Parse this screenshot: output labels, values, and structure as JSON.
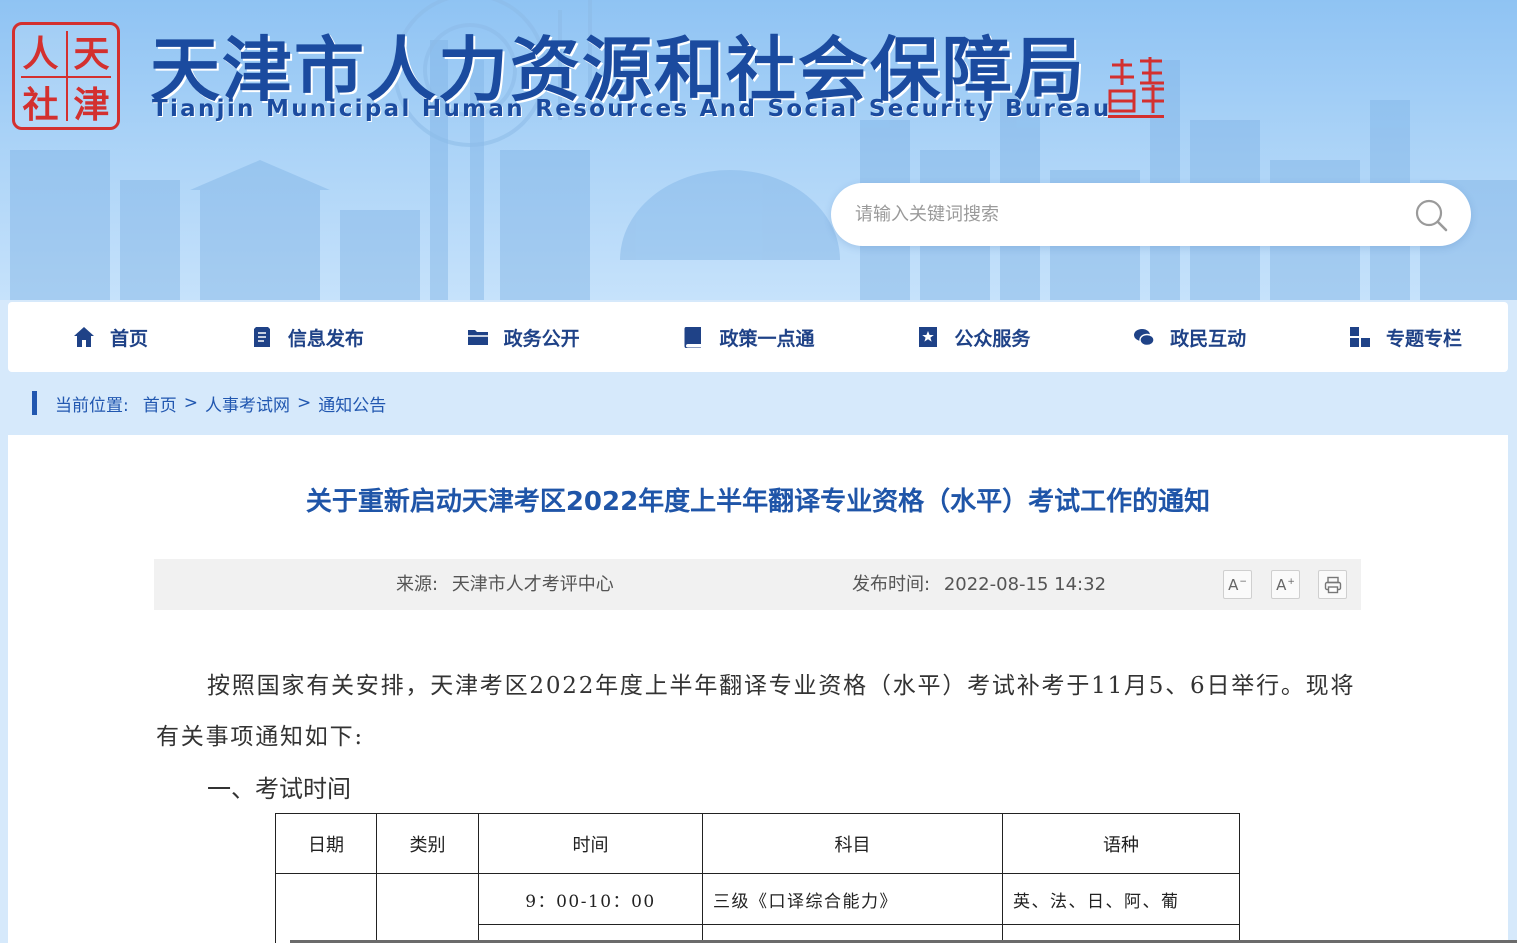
{
  "header": {
    "site_title": "天津市人力资源和社会保障局",
    "site_subtitle": "Tianjin Municipal Human Resources And Social Security Bureau",
    "seal_chars": [
      "人",
      "天",
      "社",
      "津"
    ],
    "brand_color": "#1b4b9f",
    "seal_color": "#d3302f",
    "search": {
      "placeholder": "请输入关键词搜索",
      "icon": "search-icon"
    }
  },
  "nav": {
    "items": [
      {
        "label": "首页",
        "icon": "home-icon"
      },
      {
        "label": "信息发布",
        "icon": "document-icon"
      },
      {
        "label": "政务公开",
        "icon": "folder-icon"
      },
      {
        "label": "政策一点通",
        "icon": "book-icon"
      },
      {
        "label": "公众服务",
        "icon": "star-bookmark-icon"
      },
      {
        "label": "政民互动",
        "icon": "chat-icon"
      },
      {
        "label": "专题专栏",
        "icon": "grid-icon"
      }
    ]
  },
  "breadcrumb": {
    "label": "当前位置:",
    "items": [
      "首页",
      "人事考试网",
      "通知公告"
    ],
    "separator": ">"
  },
  "article": {
    "title": "关于重新启动天津考区2022年度上半年翻译专业资格（水平）考试工作的通知",
    "source_label": "来源:",
    "source": "天津市人才考评中心",
    "date_label": "发布时间:",
    "date": "2022-08-15 14:32",
    "tools": [
      {
        "label": "A",
        "sup": "−",
        "icon": "font-decrease-icon"
      },
      {
        "label": "A",
        "sup": "+",
        "icon": "font-increase-icon"
      },
      {
        "icon": "print-icon"
      }
    ],
    "paragraph": "按照国家有关安排，天津考区2022年度上半年翻译专业资格（水平）考试补考于11月5、6日举行。现将有关事项通知如下:",
    "section_heading": "一、考试时间",
    "table": {
      "headers": [
        "日期",
        "类别",
        "时间",
        "科目",
        "语种"
      ],
      "rows": [
        [
          "",
          "",
          "9：00-10：00",
          "三级《口译综合能力》",
          "英、法、日、阿、葡"
        ]
      ]
    }
  },
  "colors": {
    "accent": "#1f55a8",
    "nav_text": "#1f4287",
    "link": "#2157b0",
    "meta_bg": "#f1f1f1"
  }
}
